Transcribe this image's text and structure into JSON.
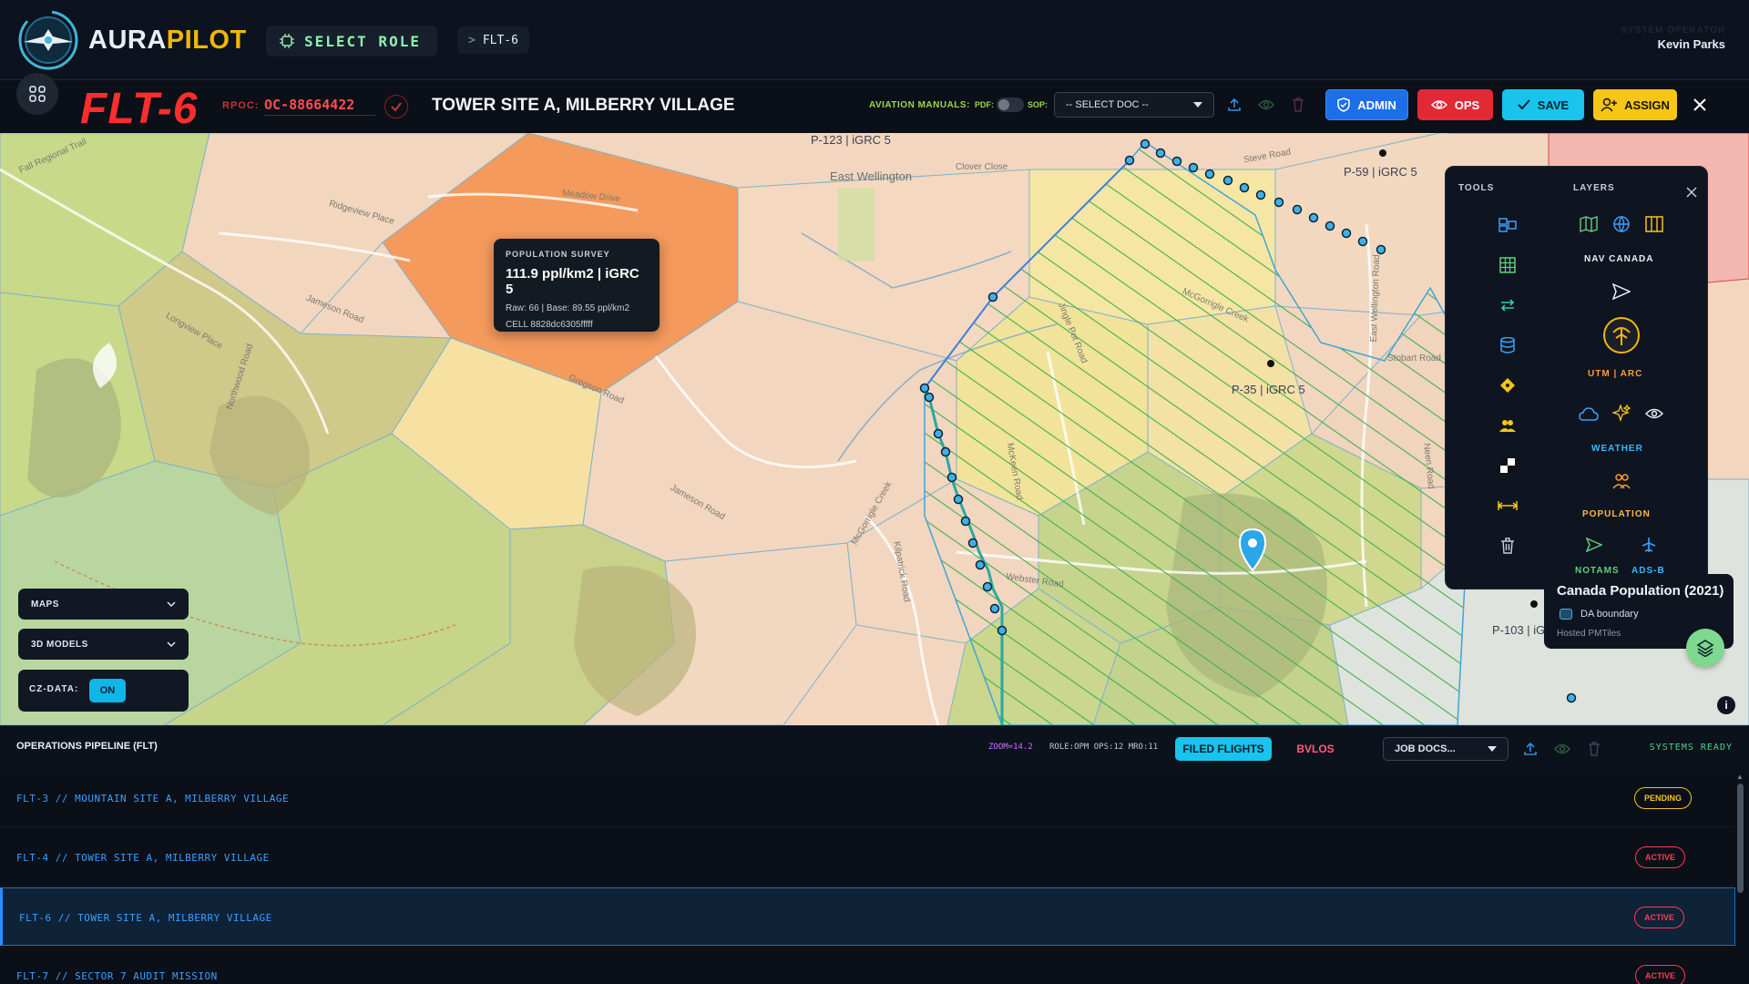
{
  "app": {
    "brand_a": "AURA",
    "brand_b": "PILOT",
    "role_button": "SELECT ROLE",
    "breadcrumb": "FLT-6",
    "breadcrumb_prefix": ">",
    "user_subtitle": "SYSTEM OPERATOR",
    "user_name": "Kevin Parks"
  },
  "mission": {
    "flight_id": "FLT-6",
    "rpoc_label": "RPOC:",
    "rpoc_value": "OC-88664422",
    "site": "TOWER SITE A, MILBERRY VILLAGE",
    "manuals_label": "AVIATION MANUALS:",
    "pdf_label": "PDF:",
    "sop_label": "SOP:",
    "doc_select": "-- SELECT DOC --",
    "buttons": {
      "admin": "ADMIN",
      "ops": "OPS",
      "save": "SAVE",
      "assign": "ASSIGN"
    }
  },
  "map": {
    "places": [
      "East Wellington"
    ],
    "roads": [
      "Meadow Drive",
      "Ridgeview Place",
      "Jameson Road",
      "Longview Place",
      "Northwood Road",
      "Gregson Road",
      "Jameson Road",
      "McGorrigle Creek",
      "Kilpatrick Road",
      "Webster Road",
      "Clover Close",
      "McGorrigle Creek",
      "Jingle Pot Road",
      "McKeen Road",
      "East Wellington Road",
      "Stobart Road",
      "Neen Road",
      "Fall Regional Trail",
      "Steve Road"
    ],
    "cell_labels": [
      "P-123 | iGRC 5",
      "P-59 | iGRC 5",
      "P-35 | iGRC 5",
      "P-103 | iG"
    ],
    "tooltip": {
      "heading": "POPULATION SURVEY",
      "value": "111.9 ppl/km2 | iGRC 5",
      "raw": "Raw: 66 | Base: 89.55 ppl/km2",
      "cell": "CELL 8828dc6305fffff"
    },
    "controls": {
      "maps": "MAPS",
      "models": "3D MODELS",
      "cz_label": "CZ-DATA:",
      "cz_state": "ON"
    },
    "panel": {
      "tools_title": "TOOLS",
      "layers_title": "LAYERS",
      "nav_canada": "NAV CANADA",
      "utm_arc": "UTM | ARC",
      "weather": "WEATHER",
      "population": "POPULATION",
      "notams": "NOTAMS",
      "adsb": "ADS-B"
    },
    "legend": {
      "title": "Canada Population (2021)",
      "item": "DA boundary",
      "source": "Hosted PMTiles"
    }
  },
  "pipeline": {
    "title": "OPERATIONS PIPELINE (FLT)",
    "zoom": "ZOOM=14.2",
    "role_stats": "ROLE:OPM OPS:12 MRO:11",
    "tab_filed": "FILED FLIGHTS",
    "tab_bvlos": "BVLOS",
    "job_docs": "JOB DOCS...",
    "status": "SYSTEMS READY",
    "rows": [
      {
        "name": "FLT-3 // MOUNTAIN SITE A, MILBERRY VILLAGE",
        "status": "PENDING"
      },
      {
        "name": "FLT-4 // TOWER SITE A, MILBERRY VILLAGE",
        "status": "ACTIVE"
      },
      {
        "name": "FLT-6 // TOWER SITE A, MILBERRY VILLAGE",
        "status": "ACTIVE"
      },
      {
        "name": "FLT-7 // SECTOR 7 AUDIT MISSION",
        "status": "ACTIVE"
      }
    ]
  },
  "colors": {
    "accent_cyan": "#18c4ec",
    "danger": "#ff3b4f",
    "warning": "#f5c518",
    "brand_gold": "#f2b705",
    "zone_green": "#4caf50",
    "survey_orange": "#f49a5c"
  }
}
